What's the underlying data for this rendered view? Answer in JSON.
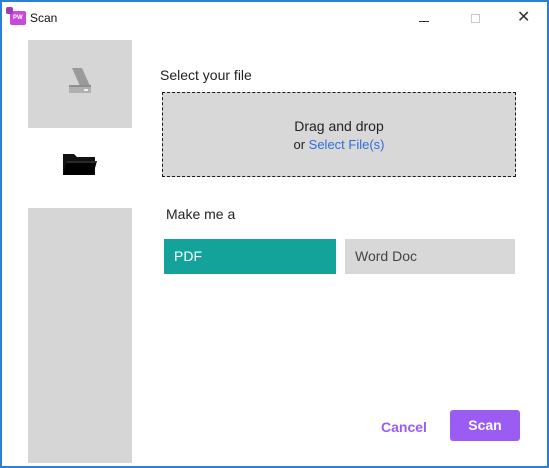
{
  "window": {
    "title": "Scan",
    "app_icon": "scan-app-icon",
    "app_icon_text": "PW",
    "controls": {
      "minimize_icon": "minimize-icon",
      "maximize_icon": "maximize-icon",
      "close_icon": "close-icon",
      "close_glyph": "✕"
    },
    "border_color": "#2b7fd6"
  },
  "sidebar": {
    "items": [
      {
        "icon": "scanner-icon",
        "selected": false
      },
      {
        "icon": "folder-icon",
        "selected": true
      }
    ]
  },
  "main": {
    "select_label": "Select your file",
    "dropzone": {
      "primary_text": "Drag and drop",
      "or_text": "or",
      "link_text": "Select File(s)"
    },
    "make_label": "Make me a",
    "options": [
      {
        "label": "PDF",
        "selected": true
      },
      {
        "label": "Word Doc",
        "selected": false
      }
    ],
    "cancel_label": "Cancel",
    "scan_label": "Scan"
  },
  "colors": {
    "accent_purple": "#9b5cf4",
    "selected_teal": "#14a39a",
    "link_blue": "#2f6fd8",
    "panel_gray": "#d6d6d6"
  }
}
